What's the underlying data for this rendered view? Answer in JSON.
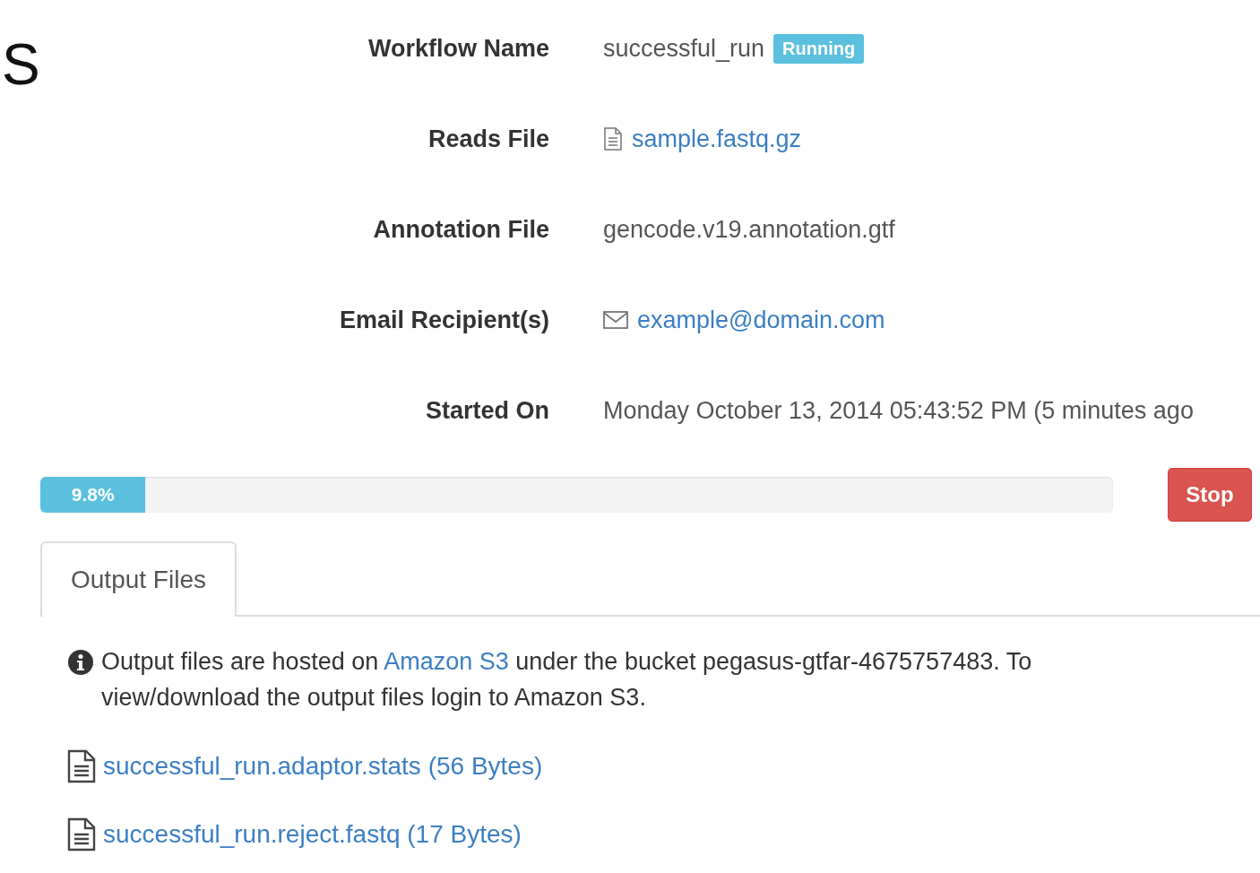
{
  "heading": "S",
  "details": [
    {
      "label": "Workflow Name",
      "kind": "text",
      "value": "successful_run",
      "badge": "Running"
    },
    {
      "label": "Reads File",
      "kind": "file",
      "value": "sample.fastq.gz"
    },
    {
      "label": "Annotation File",
      "kind": "text",
      "value": "gencode.v19.annotation.gtf"
    },
    {
      "label": "Email Recipient(s)",
      "kind": "email",
      "value": "example@domain.com"
    },
    {
      "label": "Started On",
      "kind": "text",
      "value": "Monday October 13, 2014 05:43:52 PM (5 minutes ago"
    }
  ],
  "progress": {
    "level": 0.098,
    "label": "9.8%"
  },
  "stop_button": "Stop",
  "tabs": [
    {
      "label": "Output Files",
      "selected": true
    }
  ],
  "info": {
    "before": "Output files are hosted on",
    "link": "Amazon S3",
    "after": "under the bucket pegasus-gtfar-4675757483. To view/download the output files login to Amazon S3."
  },
  "files": [
    {
      "name": "successful_run.adaptor.stats (56 Bytes)"
    },
    {
      "name": "successful_run.reject.fastq (17 Bytes)"
    }
  ]
}
